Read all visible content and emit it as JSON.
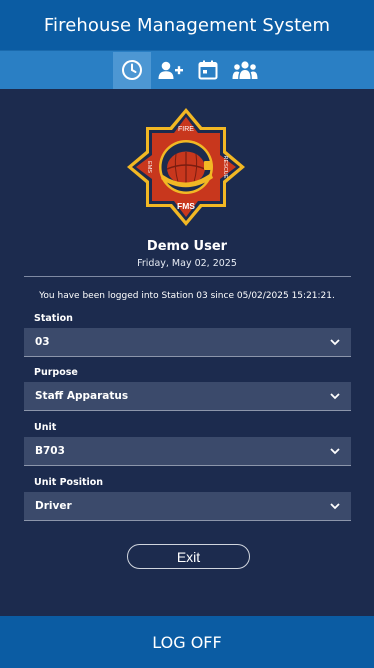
{
  "header": {
    "title": "Firehouse Management System"
  },
  "tabs": [
    {
      "icon": "clock-icon",
      "active": true
    },
    {
      "icon": "add-user-icon",
      "active": false
    },
    {
      "icon": "calendar-icon",
      "active": false
    },
    {
      "icon": "group-icon",
      "active": false
    }
  ],
  "logo": {
    "top": "FIRE",
    "left": "EMS",
    "right": "RESCUE",
    "bottom": "FMS"
  },
  "user": {
    "name": "Demo User",
    "date": "Friday, May 02, 2025"
  },
  "login_message": "You have been logged into Station 03 since 05/02/2025 15:21:21.",
  "fields": [
    {
      "label": "Station",
      "value": "03"
    },
    {
      "label": "Purpose",
      "value": "Staff Apparatus"
    },
    {
      "label": "Unit",
      "value": "B703"
    },
    {
      "label": "Unit Position",
      "value": "Driver"
    }
  ],
  "exit_label": "Exit",
  "footer": {
    "label": "LOG OFF"
  },
  "colors": {
    "header": "#0b5ca3",
    "tabbar": "#2a7fc4",
    "background": "#1c2b4e",
    "select": "#3b4a6b",
    "logo_red": "#c8371d",
    "logo_gold": "#f2b824"
  }
}
